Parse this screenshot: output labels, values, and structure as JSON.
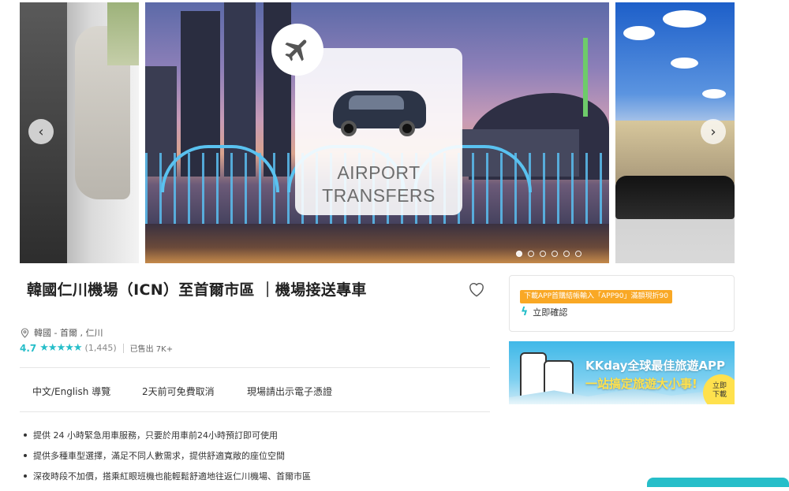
{
  "carousel": {
    "card_line1": "AIRPORT",
    "card_line2": "TRANSFERS",
    "dots_count": 6,
    "active_dot": 0,
    "prev_icon": "chevron-left-icon",
    "next_icon": "chevron-right-icon"
  },
  "product": {
    "title": "韓國仁川機場（ICN）至首爾市區 ｜機場接送專車",
    "location": "韓國 - 首爾 , 仁川",
    "rating": "4.7",
    "stars": "★★★★★",
    "reviews": "(1,445)",
    "sold": "已售出 7K+",
    "features": [
      "中文/English 導覽",
      "2天前可免費取消",
      "現場請出示電子憑證"
    ],
    "bullets": [
      "提供 24 小時緊急用車服務，只要於用車前24小時預訂即可使用",
      "提供多種車型選擇，滿足不同人數需求，提供舒適寬敞的座位空間",
      "深夜時段不加價，搭乘紅眼班機也能輕鬆舒適地往返仁川機場、首爾市區"
    ]
  },
  "sidebar": {
    "promo_tag": "下載APP首購結帳輸入「APP90」滿額現折90",
    "instant_confirm": "立即確認",
    "banner_line1": "KKday全球最佳旅遊APP",
    "banner_line2": "一站搞定旅遊大小事!",
    "banner_badge_line1": "立即",
    "banner_badge_line2": "下載"
  },
  "colors": {
    "accent": "#26bec9",
    "promo": "#f9a825"
  }
}
